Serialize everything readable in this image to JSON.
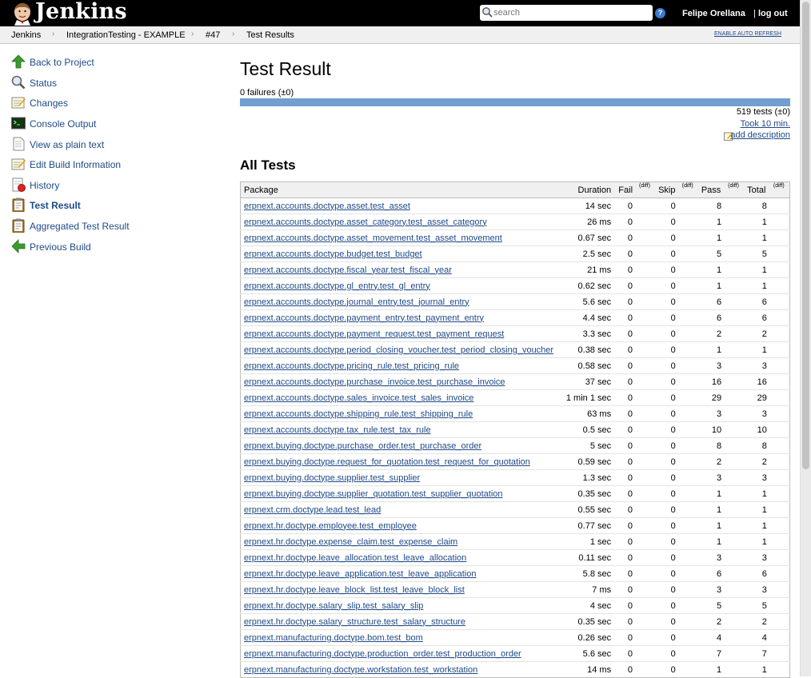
{
  "header": {
    "brand": "Jenkins",
    "search_placeholder": "search",
    "help": "?",
    "user": "Felipe Orellana",
    "logout_sep": "|",
    "logout": "log out"
  },
  "breadcrumb": {
    "items": [
      "Jenkins",
      "IntegrationTesting - EXAMPLE",
      "#47",
      "Test Results"
    ],
    "auto_refresh": "ENABLE AUTO REFRESH"
  },
  "side_panel": [
    {
      "label": "Back to Project",
      "icon": "up-arrow-icon"
    },
    {
      "label": "Status",
      "icon": "magnifier-icon"
    },
    {
      "label": "Changes",
      "icon": "notepad-icon"
    },
    {
      "label": "Console Output",
      "icon": "terminal-icon"
    },
    {
      "label": "View as plain text",
      "icon": "document-icon"
    },
    {
      "label": "Edit Build Information",
      "icon": "notepad-icon"
    },
    {
      "label": "History",
      "icon": "history-icon"
    },
    {
      "label": "Test Result",
      "icon": "clipboard-icon",
      "active": true
    },
    {
      "label": "Aggregated Test Result",
      "icon": "clipboard-icon"
    },
    {
      "label": "Previous Build",
      "icon": "left-arrow-icon"
    }
  ],
  "main": {
    "title": "Test Result",
    "failures": "0 failures (±0)",
    "pass_fraction": 1.0,
    "tests_count": "519 tests (±0)",
    "took": "Took 10 min.",
    "add_description": "add description",
    "all_tests_heading": "All Tests"
  },
  "table": {
    "headers": {
      "package": "Package",
      "duration": "Duration",
      "fail": "Fail",
      "diff": "(diff)",
      "skip": "Skip",
      "pass": "Pass",
      "total": "Total"
    },
    "rows": [
      {
        "package": "erpnext.accounts.doctype.asset.test_asset",
        "duration": "14 sec",
        "fail": "0",
        "skip": "0",
        "pass": "8",
        "total": "8"
      },
      {
        "package": "erpnext.accounts.doctype.asset_category.test_asset_category",
        "duration": "26 ms",
        "fail": "0",
        "skip": "0",
        "pass": "1",
        "total": "1"
      },
      {
        "package": "erpnext.accounts.doctype.asset_movement.test_asset_movement",
        "duration": "0.67 sec",
        "fail": "0",
        "skip": "0",
        "pass": "1",
        "total": "1"
      },
      {
        "package": "erpnext.accounts.doctype.budget.test_budget",
        "duration": "2.5 sec",
        "fail": "0",
        "skip": "0",
        "pass": "5",
        "total": "5"
      },
      {
        "package": "erpnext.accounts.doctype.fiscal_year.test_fiscal_year",
        "duration": "21 ms",
        "fail": "0",
        "skip": "0",
        "pass": "1",
        "total": "1"
      },
      {
        "package": "erpnext.accounts.doctype.gl_entry.test_gl_entry",
        "duration": "0.62 sec",
        "fail": "0",
        "skip": "0",
        "pass": "1",
        "total": "1"
      },
      {
        "package": "erpnext.accounts.doctype.journal_entry.test_journal_entry",
        "duration": "5.6 sec",
        "fail": "0",
        "skip": "0",
        "pass": "6",
        "total": "6"
      },
      {
        "package": "erpnext.accounts.doctype.payment_entry.test_payment_entry",
        "duration": "4.4 sec",
        "fail": "0",
        "skip": "0",
        "pass": "6",
        "total": "6"
      },
      {
        "package": "erpnext.accounts.doctype.payment_request.test_payment_request",
        "duration": "3.3 sec",
        "fail": "0",
        "skip": "0",
        "pass": "2",
        "total": "2"
      },
      {
        "package": "erpnext.accounts.doctype.period_closing_voucher.test_period_closing_voucher",
        "duration": "0.38 sec",
        "fail": "0",
        "skip": "0",
        "pass": "1",
        "total": "1"
      },
      {
        "package": "erpnext.accounts.doctype.pricing_rule.test_pricing_rule",
        "duration": "0.58 sec",
        "fail": "0",
        "skip": "0",
        "pass": "3",
        "total": "3"
      },
      {
        "package": "erpnext.accounts.doctype.purchase_invoice.test_purchase_invoice",
        "duration": "37 sec",
        "fail": "0",
        "skip": "0",
        "pass": "16",
        "total": "16"
      },
      {
        "package": "erpnext.accounts.doctype.sales_invoice.test_sales_invoice",
        "duration": "1 min 1 sec",
        "fail": "0",
        "skip": "0",
        "pass": "29",
        "total": "29"
      },
      {
        "package": "erpnext.accounts.doctype.shipping_rule.test_shipping_rule",
        "duration": "63 ms",
        "fail": "0",
        "skip": "0",
        "pass": "3",
        "total": "3"
      },
      {
        "package": "erpnext.accounts.doctype.tax_rule.test_tax_rule",
        "duration": "0.5 sec",
        "fail": "0",
        "skip": "0",
        "pass": "10",
        "total": "10"
      },
      {
        "package": "erpnext.buying.doctype.purchase_order.test_purchase_order",
        "duration": "5 sec",
        "fail": "0",
        "skip": "0",
        "pass": "8",
        "total": "8"
      },
      {
        "package": "erpnext.buying.doctype.request_for_quotation.test_request_for_quotation",
        "duration": "0.59 sec",
        "fail": "0",
        "skip": "0",
        "pass": "2",
        "total": "2"
      },
      {
        "package": "erpnext.buying.doctype.supplier.test_supplier",
        "duration": "1.3 sec",
        "fail": "0",
        "skip": "0",
        "pass": "3",
        "total": "3"
      },
      {
        "package": "erpnext.buying.doctype.supplier_quotation.test_supplier_quotation",
        "duration": "0.35 sec",
        "fail": "0",
        "skip": "0",
        "pass": "1",
        "total": "1"
      },
      {
        "package": "erpnext.crm.doctype.lead.test_lead",
        "duration": "0.55 sec",
        "fail": "0",
        "skip": "0",
        "pass": "1",
        "total": "1"
      },
      {
        "package": "erpnext.hr.doctype.employee.test_employee",
        "duration": "0.77 sec",
        "fail": "0",
        "skip": "0",
        "pass": "1",
        "total": "1"
      },
      {
        "package": "erpnext.hr.doctype.expense_claim.test_expense_claim",
        "duration": "1 sec",
        "fail": "0",
        "skip": "0",
        "pass": "1",
        "total": "1"
      },
      {
        "package": "erpnext.hr.doctype.leave_allocation.test_leave_allocation",
        "duration": "0.11 sec",
        "fail": "0",
        "skip": "0",
        "pass": "3",
        "total": "3"
      },
      {
        "package": "erpnext.hr.doctype.leave_application.test_leave_application",
        "duration": "5.8 sec",
        "fail": "0",
        "skip": "0",
        "pass": "6",
        "total": "6"
      },
      {
        "package": "erpnext.hr.doctype.leave_block_list.test_leave_block_list",
        "duration": "7 ms",
        "fail": "0",
        "skip": "0",
        "pass": "3",
        "total": "3"
      },
      {
        "package": "erpnext.hr.doctype.salary_slip.test_salary_slip",
        "duration": "4 sec",
        "fail": "0",
        "skip": "0",
        "pass": "5",
        "total": "5"
      },
      {
        "package": "erpnext.hr.doctype.salary_structure.test_salary_structure",
        "duration": "0.35 sec",
        "fail": "0",
        "skip": "0",
        "pass": "2",
        "total": "2"
      },
      {
        "package": "erpnext.manufacturing.doctype.bom.test_bom",
        "duration": "0.26 sec",
        "fail": "0",
        "skip": "0",
        "pass": "4",
        "total": "4"
      },
      {
        "package": "erpnext.manufacturing.doctype.production_order.test_production_order",
        "duration": "5.6 sec",
        "fail": "0",
        "skip": "0",
        "pass": "7",
        "total": "7"
      },
      {
        "package": "erpnext.manufacturing.doctype.workstation.test_workstation",
        "duration": "14 ms",
        "fail": "0",
        "skip": "0",
        "pass": "1",
        "total": "1"
      }
    ]
  },
  "colors": {
    "header_bg": "#000000",
    "link": "#204a87",
    "progress_pass": "#729fcf"
  }
}
